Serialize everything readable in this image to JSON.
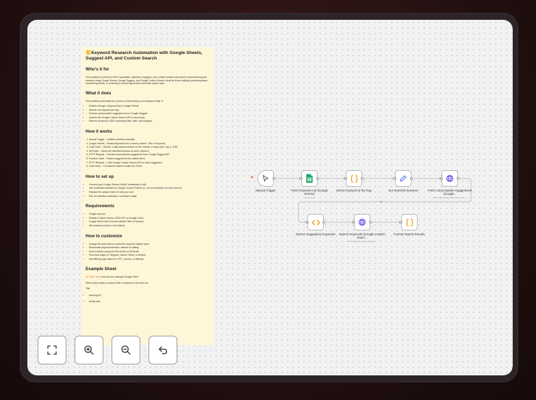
{
  "note": {
    "title": "📒Keyword Research Automation with Google Sheets, Suggest API, and Custom Search",
    "sections": [
      {
        "heading": "Who's it for",
        "paragraph": "This workflow is perfect for SEO specialists, marketers, bloggers, and content creators who want to automate keyword research using Google Sheets, Google Suggest, and Google Custom Search. Ideal for those building content pipelines, researching trends, or powering AI content generation with fresh search data."
      },
      {
        "heading": "What it does",
        "paragraph": "This workflow automates the process of discovering a new keyword daily. It:",
        "items": [
          "Rotates through a keyword list in Google Sheets",
          "Selects one keyword per day",
          "Fetches autocomplete suggestions from Google Suggest",
          "Queries the Google Custom Search API for top results",
          "Returns structured JSON containing titles, links, and snippets"
        ]
      },
      {
        "heading": "How it works",
        "items": [
          "Manual Trigger – Initiates workflow manually",
          "Google Sheets – Reads keywords from a sheet (column: Title or Keyword)",
          "Code Node – Selects a daily keyword based on the number of days since July 4, 2025",
          "Set Node – Saves the selected keyword as seed_keyword",
          "HTTP Request – Fetches autocomplete suggestions from Google Suggest API",
          "Function Node – Parses suggestions into usable items",
          "HTTP Request – Calls Google Custom Search API for each suggestion",
          "Code Node – Formats the search results into JSON"
        ]
      },
      {
        "heading": "How to set up",
        "items": [
          "Connect your Google Sheets OAuth2 credentials in n8n",
          "Use credential variables for Google Custom Search (i.e. do not hardcode your key and cx)",
          "Replace the sample sheet ID with your own",
          "Run the workflow manually or schedule it daily"
        ]
      },
      {
        "heading": "Requirements",
        "items": [
          "Google account",
          "Enabled Custom Search JSON API on Google Cloud",
          "Google Sheet with a column labeled Title or Keyword",
          "n8n instance (cloud or self-hosted)"
        ]
      },
      {
        "heading": "How to customize",
        "items": [
          "Change the start date to control the keyword rotation cycle",
          "Randomize keyword selection instead of rotating",
          "Enrich results using tools like Ahrefs or SEMrush",
          "Push final output to Telegram, Notion, Slack, or Airtable",
          "Add filtering logic based on CPC, volume, or difficulty"
        ]
      }
    ],
    "example": {
      "heading": "Example Sheet",
      "link_prefix": "👉",
      "link_text": "Click Here",
      "link_suffix": " to access the example Google Sheet",
      "line2": "Sheet must contain a column Title or Keyword in the first row:",
      "column": "Title",
      "items": [
        "teknologi AI",
        "kecilla stiel"
      ]
    }
  },
  "nodes": [
    {
      "id": "manual-trigger",
      "label": "Manual Trigger",
      "sub": "",
      "icon": "cursor-click-icon",
      "color": "#555555"
    },
    {
      "id": "fetch-keyword-list",
      "label": "Fetch Keyword List (Google Sheets)",
      "sub": "read: sheet",
      "icon": "google-sheets-icon",
      "color": "#21a366"
    },
    {
      "id": "select-keyword",
      "label": "Select Keyword of the Day",
      "sub": "",
      "icon": "code-braces-icon",
      "color": "#f39c12"
    },
    {
      "id": "set-selected-keyword",
      "label": "Set Selected Keyword",
      "sub": "",
      "icon": "pencil-icon",
      "color": "#3b66f5"
    },
    {
      "id": "fetch-autocomplete",
      "label": "Fetch Autocomplete Suggestions (Google...",
      "sub": "GET: https://suggestqueries.google...",
      "icon": "globe-icon",
      "color": "#5b3ee8"
    },
    {
      "id": "extract-suggestion",
      "label": "Extract Suggestion Keywords",
      "sub": "",
      "icon": "code-icon",
      "color": "#f39c12"
    },
    {
      "id": "search-keywords",
      "label": "Search Keywords (Google Custom Searc...",
      "sub": "GET: https://www.googleapis...",
      "icon": "globe-icon",
      "color": "#5b3ee8"
    },
    {
      "id": "format-results",
      "label": "Format Search Results",
      "sub": "",
      "icon": "code-braces-icon",
      "color": "#f39c12"
    }
  ],
  "controls": {
    "fit": "fit-view-icon",
    "zoom_in": "zoom-in-icon",
    "zoom_out": "zoom-out-icon",
    "undo": "undo-icon"
  },
  "colors": {
    "accent": "#e0623c",
    "note_bg": "#fff6d8",
    "canvas_bg": "#f2f2f2"
  }
}
